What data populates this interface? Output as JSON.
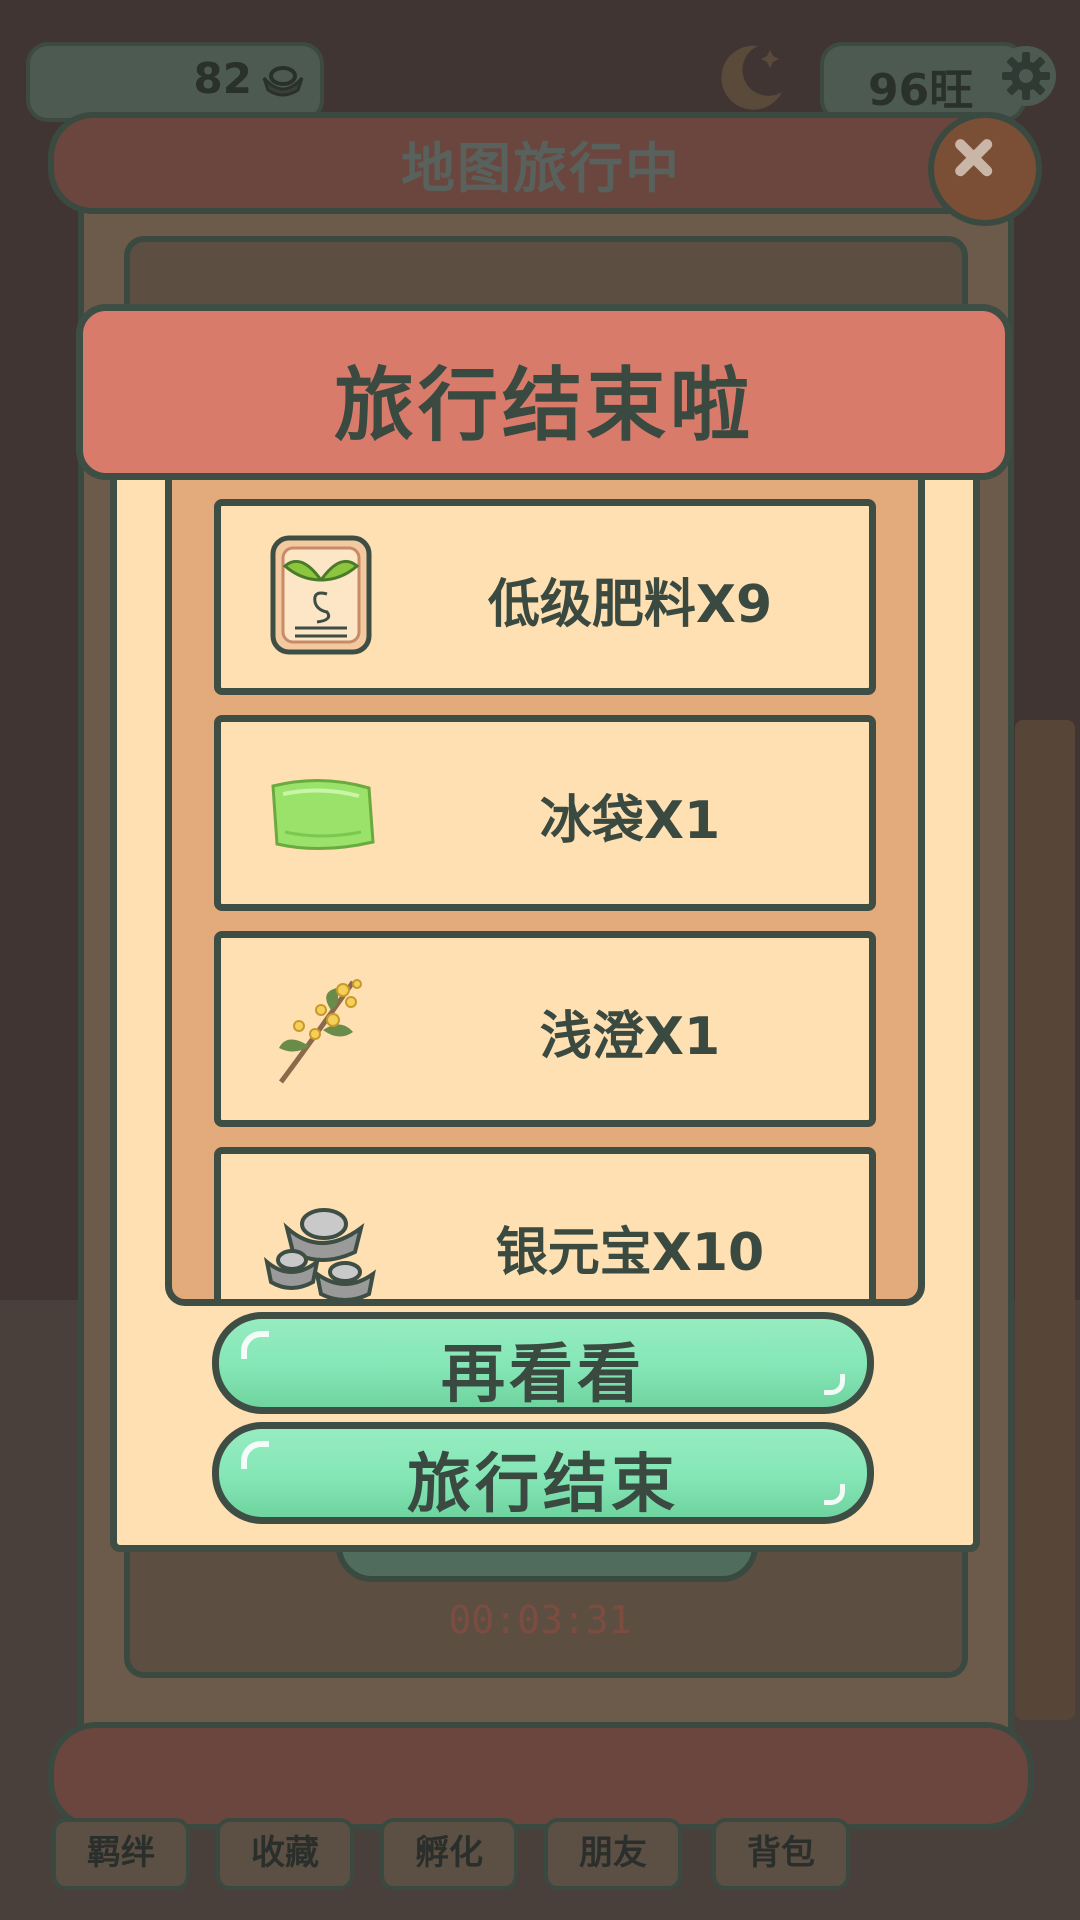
{
  "hud": {
    "silver_count": "82",
    "wang_count": "96旺"
  },
  "back_panel": {
    "title": "地图旅行中",
    "timer": "00:03:31"
  },
  "bottom_nav": [
    {
      "label": "羁绊"
    },
    {
      "label": "收藏"
    },
    {
      "label": "孵化"
    },
    {
      "label": "朋友"
    },
    {
      "label": "背包"
    }
  ],
  "modal": {
    "title": "旅行结束啦",
    "rewards": [
      {
        "label": "低级肥料X9",
        "icon": "fertilizer-bag-icon"
      },
      {
        "label": "冰袋X1",
        "icon": "ice-bag-icon"
      },
      {
        "label": "浅澄X1",
        "icon": "osmanthus-flower-icon"
      },
      {
        "label": "银元宝X10",
        "icon": "silver-ingot-icon"
      }
    ],
    "buttons": {
      "look_again": "再看看",
      "end_travel": "旅行结束"
    }
  },
  "colors": {
    "modal_bg": "#fee0b2",
    "header_bg": "#d97b6a",
    "button_green": "#84e6b6",
    "outline": "#3e4e44"
  }
}
